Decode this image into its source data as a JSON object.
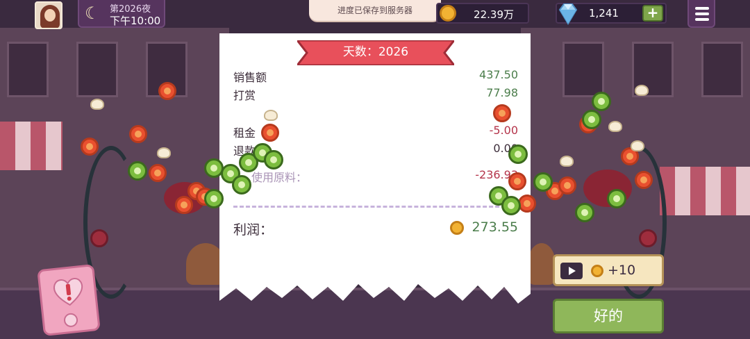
{
  "hud": {
    "night_label": "第2026夜",
    "time_label": "下午10:00",
    "toast": "进度已保存到服务器",
    "coins": "22.39万",
    "gems": "1,241",
    "gem_plus": "+"
  },
  "receipt": {
    "day_banner": "天数：2026",
    "rows": [
      {
        "label": "销售额",
        "value": "437.50",
        "tone": "green"
      },
      {
        "label": "打赏",
        "value": "77.98",
        "tone": "green"
      },
      {
        "label": "租金",
        "value": "-5.00",
        "tone": "red"
      },
      {
        "label": "退款",
        "value": "0.00",
        "tone": "dark"
      },
      {
        "label": "使用原料：",
        "value": "-236.93",
        "tone": "red"
      }
    ],
    "profit_label": "利润：",
    "profit_value": "273.55"
  },
  "buttons": {
    "ad_reward": "+10",
    "ok": "好的"
  },
  "icons": {
    "moon": "moon-icon",
    "coin": "coin-icon",
    "gem": "diamond-icon",
    "menu": "hamburger-menu-icon",
    "play": "video-play-icon",
    "phone": "phone-heart-alert-icon"
  },
  "colors": {
    "positive": "#4b7d4b",
    "negative": "#b4344a",
    "banner": "#e8505b",
    "ok_button": "#8fb75a"
  }
}
